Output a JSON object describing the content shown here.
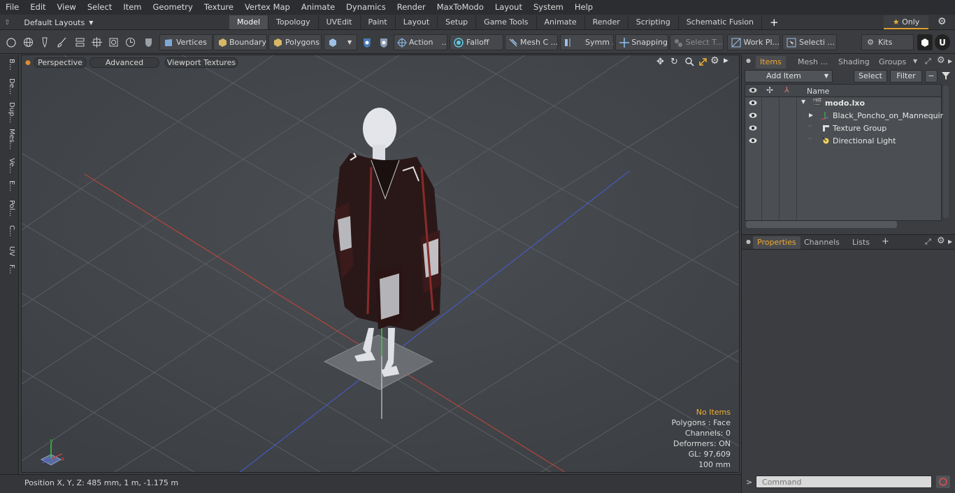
{
  "menu": [
    "File",
    "Edit",
    "View",
    "Select",
    "Item",
    "Geometry",
    "Texture",
    "Vertex Map",
    "Animate",
    "Dynamics",
    "Render",
    "MaxToModo",
    "Layout",
    "System",
    "Help"
  ],
  "layout_selector": {
    "label": "Default Layouts"
  },
  "tabs": [
    "Model",
    "Topology",
    "UVEdit",
    "Paint",
    "Layout",
    "Setup",
    "Game Tools",
    "Animate",
    "Render",
    "Scripting",
    "Schematic Fusion"
  ],
  "only_label": "Only",
  "toolbar": {
    "vertices": "Vertices",
    "boundary": "Boundary",
    "polygons": "Polygons",
    "action": "Action",
    "falloff": "Falloff",
    "mesh_c": "Mesh C ...",
    "symm": "Symm ...",
    "snapping": "Snapping",
    "select_t": "Select T...",
    "work_pl": "Work Pl...",
    "selecti": "Selecti ...",
    "kits": "Kits"
  },
  "left_tabs": [
    "B...",
    "De...",
    "Dup...",
    "Mes...",
    "Ve...",
    "E...",
    "Pol...",
    "C...",
    "UV",
    "F..."
  ],
  "viewport": {
    "perspective": "Perspective",
    "advanced": "Advanced",
    "viewport_textures": "Viewport Textures",
    "info": {
      "no_items": "No Items",
      "polygons": "Polygons : Face",
      "channels": "Channels: 0",
      "deformers": "Deformers: ON",
      "gl": "GL: 97,609",
      "scale": "100 mm"
    }
  },
  "status": {
    "position": "Position X, Y, Z:   485 mm, 1 m, -1.175 m"
  },
  "items_panel": {
    "tabs": [
      "Items",
      "Mesh ...",
      "Shading",
      "Groups"
    ],
    "add_item": "Add Item",
    "select": "Select",
    "filter": "Filter",
    "name_header": "Name",
    "tree": [
      {
        "label": "modo.lxo",
        "bold": true
      },
      {
        "label": "Black_Poncho_on_Mannequin"
      },
      {
        "label": "Texture Group"
      },
      {
        "label": "Directional Light"
      }
    ]
  },
  "properties_panel": {
    "tabs": [
      "Properties",
      "Channels",
      "Lists"
    ]
  },
  "command": {
    "placeholder": "Command"
  },
  "colors": {
    "accent": "#e0a030",
    "x_axis": "#c8453a",
    "y_axis": "#3cc84a",
    "z_axis": "#4a5cd8"
  }
}
